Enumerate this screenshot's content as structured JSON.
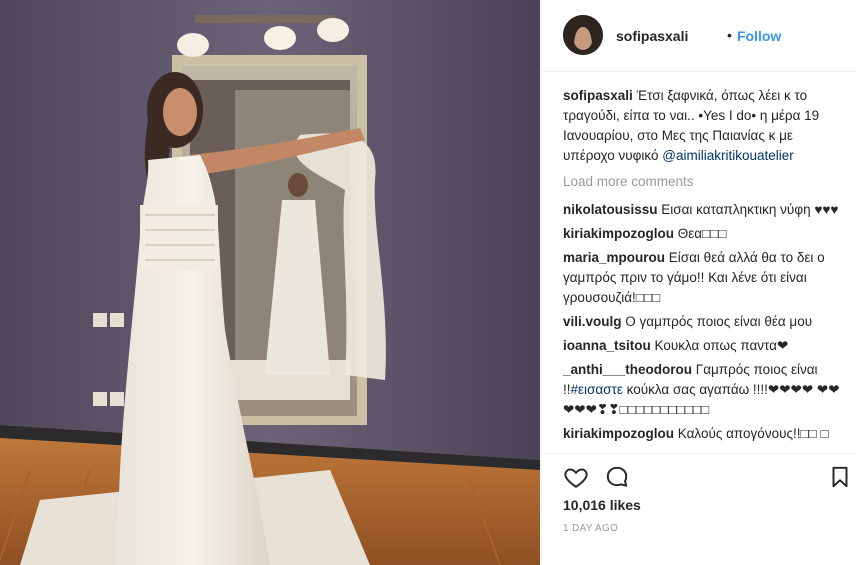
{
  "post": {
    "username": "sofipasxali",
    "separator": "•",
    "follow_label": "Follow",
    "caption_user": "sofipasxali",
    "caption_text": "Έτσι ξαφνικά, όπως λέει κ το τραγούδι, είπα το ναι.. •Yes I do• η μέρα 19 Ιανουαρίου, στο Μες της Παιανίας κ με υπέροχο νυφικό",
    "caption_mention": "@aimiliakritikouatelier",
    "load_more": "Load more comments",
    "likes": "10,016 likes",
    "timestamp": "1 DAY AGO"
  },
  "comments": [
    {
      "user": "nikolatousissu",
      "text": "Εισαι καταπληκτικη νύφη ♥♥♥"
    },
    {
      "user": "kiriakimpozoglou",
      "text": "Θεα□□□"
    },
    {
      "user": "maria_mpourou",
      "text": "Είσαι θεά αλλά θα το δει ο γαμπρός πριν το γάμο!! Και λένε ότι είναι γρουσουζιά!□□□"
    },
    {
      "user": "vili.voulg",
      "text": "Ο γαμπρός ποιος είναι θέα μου"
    },
    {
      "user": "ioanna_tsitou",
      "text": "Κουκλα οπως παντα❤"
    },
    {
      "user": "_anthi___theodorou",
      "text": "Γαμπρός ποιος είναι !!",
      "hashtag": "#εισαστε",
      "text2": " κούκλα σας αγαπάω !!!!❤❤❤❤ ❤❤❤❤❤❣❣□□□□□□□□□□□"
    },
    {
      "user": "kiriakimpozoglou",
      "text": "Καλούς απογόνους!!□□ □"
    }
  ],
  "icons": {
    "like": "heart-icon",
    "comment": "comment-icon",
    "save": "bookmark-icon"
  },
  "colors": {
    "follow": "#3897f0",
    "link": "#003569",
    "muted": "#999999"
  }
}
